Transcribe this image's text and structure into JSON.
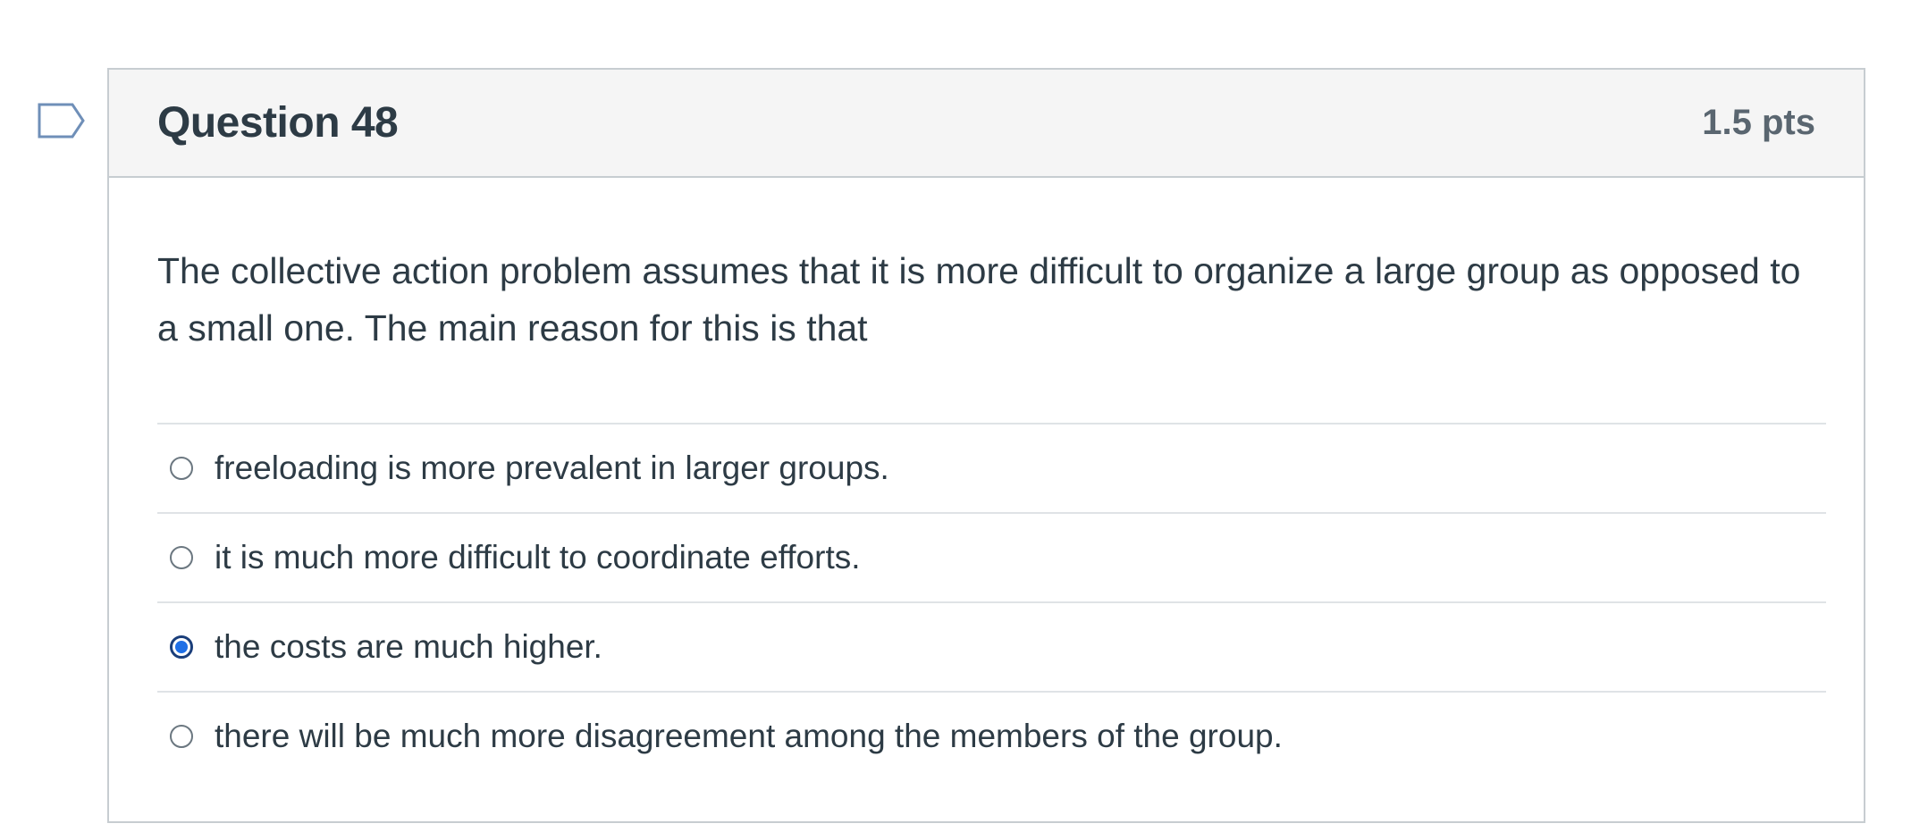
{
  "question": {
    "title": "Question 48",
    "points": "1.5 pts",
    "text": "The collective action problem assumes that it is more difficult to organize a large group as opposed to a small one. The main reason for this is that",
    "flag_icon": "flag-outline-icon",
    "answers": [
      {
        "label": "freeloading is more prevalent in larger groups.",
        "selected": false
      },
      {
        "label": "it is much more difficult to coordinate efforts.",
        "selected": false
      },
      {
        "label": "the costs are much higher.",
        "selected": true
      },
      {
        "label": "there will be much more disagreement among the members of the group.",
        "selected": false
      }
    ]
  },
  "colors": {
    "header_bg": "#f5f5f5",
    "border": "#c7cdd1",
    "text": "#2d3b45",
    "radio_selected": "#1f6fe6"
  }
}
